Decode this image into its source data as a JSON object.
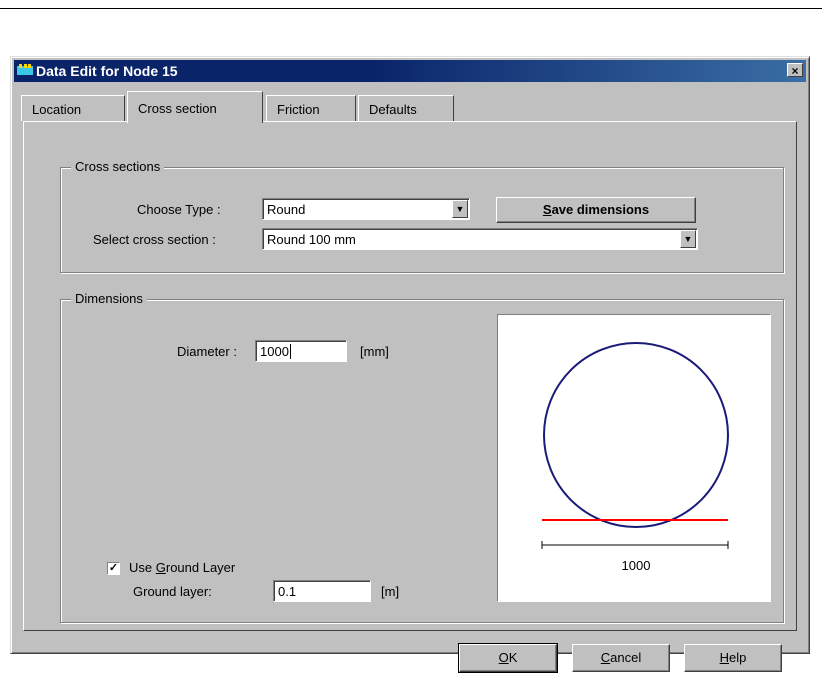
{
  "window": {
    "title": "Data Edit for Node 15",
    "close_glyph": "×"
  },
  "tabs": [
    {
      "label": "Location"
    },
    {
      "label": "Cross section"
    },
    {
      "label": "Friction"
    },
    {
      "label": "Defaults"
    }
  ],
  "cross_sections": {
    "group_label": "Cross sections",
    "choose_type_label": "Choose Type :",
    "choose_type_value": "Round",
    "save_button_prefix": "S",
    "save_button_rest": "ave dimensions",
    "select_section_label": "Select cross section :",
    "select_section_value": "Round 100 mm"
  },
  "dimensions": {
    "group_label": "Dimensions",
    "diameter_label": "Diameter :",
    "diameter_value": "1000",
    "diameter_unit": "[mm]",
    "use_ground_prefix": "Use ",
    "use_ground_mnemonic": "G",
    "use_ground_rest": "round Layer",
    "use_ground_checked": true,
    "ground_layer_label": "Ground layer:",
    "ground_layer_value": "0.1",
    "ground_layer_unit": "[m]",
    "preview_dimension_label": "1000"
  },
  "buttons": {
    "ok_mnemonic": "O",
    "ok_rest": "K",
    "cancel_mnemonic": "C",
    "cancel_rest": "ancel",
    "help_mnemonic": "H",
    "help_rest": "elp"
  },
  "colors": {
    "circle": "#1a1a7a",
    "ground_line": "#ff0000"
  },
  "icons": {
    "title": "app-icon",
    "dropdown": "chevron-down-icon",
    "check": "check-icon"
  }
}
